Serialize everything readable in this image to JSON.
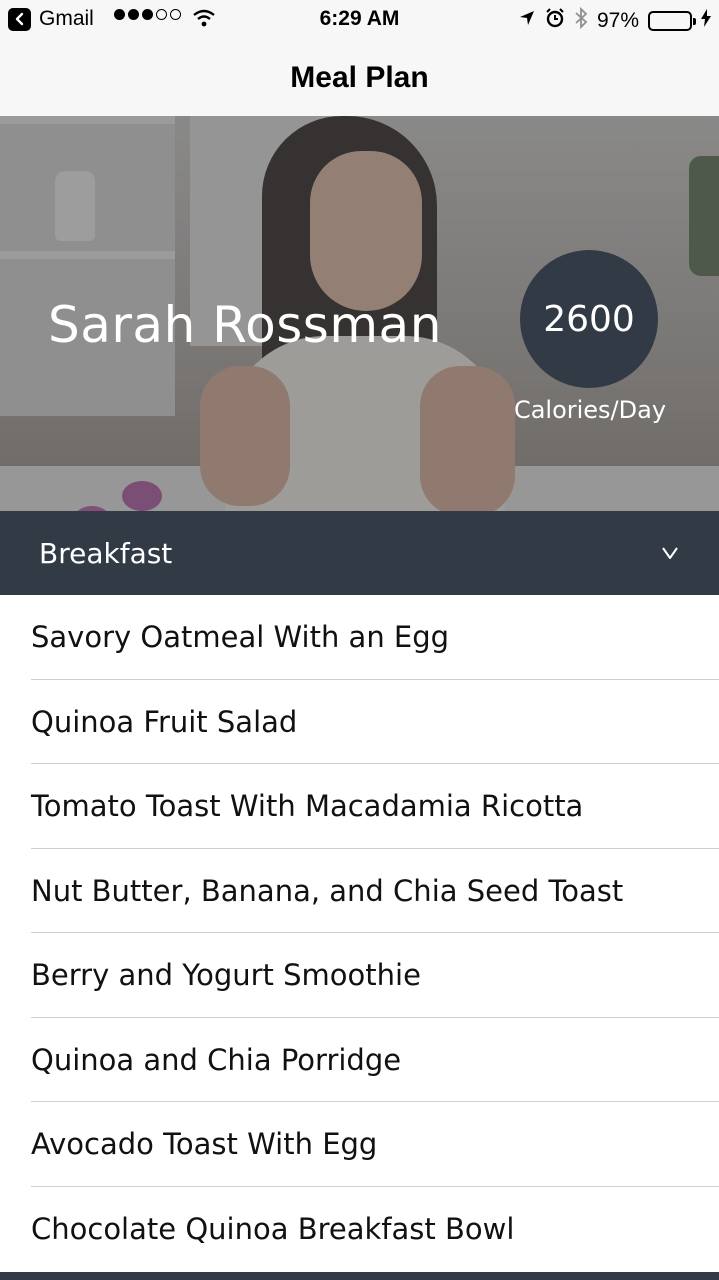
{
  "status_bar": {
    "back_app": "Gmail",
    "time": "6:29 AM",
    "battery": "97%",
    "battery_level": 0.97,
    "signal_bars": 3,
    "signal_total": 5
  },
  "nav": {
    "title": "Meal Plan"
  },
  "profile": {
    "name": "Sarah Rossman",
    "calories": "2600",
    "calories_label": "Calories/Day"
  },
  "section": {
    "title": "Breakfast",
    "expanded_icon": "chevron-down-icon"
  },
  "meals": [
    "Savory Oatmeal With an Egg",
    "Quinoa Fruit Salad",
    "Tomato Toast With Macadamia Ricotta",
    "Nut Butter, Banana, and Chia Seed Toast",
    "Berry and Yogurt Smoothie",
    "Quinoa and Chia Porridge",
    "Avocado Toast With Egg",
    "Chocolate Quinoa Breakfast Bowl"
  ],
  "colors": {
    "accent_dark": "#323a45",
    "battery_green": "#4cd964"
  }
}
